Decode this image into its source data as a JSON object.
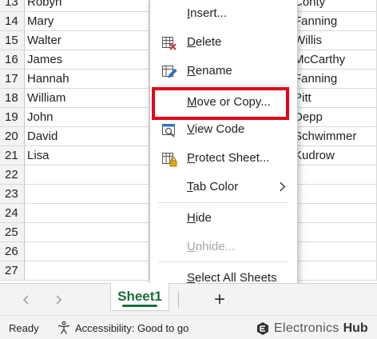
{
  "grid": {
    "rows": [
      {
        "num": "13",
        "a": "Robyn",
        "c": "Conty"
      },
      {
        "num": "14",
        "a": "Mary",
        "c": "Fanning"
      },
      {
        "num": "15",
        "a": "Walter",
        "c": "Willis"
      },
      {
        "num": "16",
        "a": "James",
        "c": "McCarthy"
      },
      {
        "num": "17",
        "a": "Hannah",
        "c": "Fanning"
      },
      {
        "num": "18",
        "a": "William",
        "c": "Pitt"
      },
      {
        "num": "19",
        "a": "John",
        "c": "Depp"
      },
      {
        "num": "20",
        "a": "David",
        "c": "Schwimmer"
      },
      {
        "num": "21",
        "a": "Lisa",
        "c": "Kudrow"
      },
      {
        "num": "22",
        "a": "",
        "c": ""
      },
      {
        "num": "23",
        "a": "",
        "c": ""
      },
      {
        "num": "24",
        "a": "",
        "c": ""
      },
      {
        "num": "25",
        "a": "",
        "c": ""
      },
      {
        "num": "26",
        "a": "",
        "c": ""
      },
      {
        "num": "27",
        "a": "",
        "c": ""
      }
    ]
  },
  "context_menu": {
    "items": [
      {
        "label_pre": "",
        "label_u": "I",
        "label_post": "nsert...",
        "icon": "",
        "disabled": false
      },
      {
        "label_pre": "",
        "label_u": "D",
        "label_post": "elete",
        "icon": "delete-sheet-icon",
        "disabled": false
      },
      {
        "label_pre": "",
        "label_u": "R",
        "label_post": "ename",
        "icon": "rename-sheet-icon",
        "disabled": false
      },
      {
        "label_pre": "",
        "label_u": "M",
        "label_post": "ove or Copy...",
        "icon": "",
        "disabled": false
      },
      {
        "label_pre": "",
        "label_u": "V",
        "label_post": "iew Code",
        "icon": "view-code-icon",
        "disabled": false
      },
      {
        "label_pre": "",
        "label_u": "P",
        "label_post": "rotect Sheet...",
        "icon": "protect-sheet-icon",
        "disabled": false
      },
      {
        "label_pre": "",
        "label_u": "T",
        "label_post": "ab Color",
        "icon": "",
        "disabled": false,
        "submenu": "chevron-right-icon"
      },
      {
        "label_pre": "",
        "label_u": "H",
        "label_post": "ide",
        "icon": "",
        "disabled": false
      },
      {
        "label_pre": "",
        "label_u": "U",
        "label_post": "nhide...",
        "icon": "",
        "disabled": true
      },
      {
        "label_pre": "",
        "label_u": "S",
        "label_post": "elect All Sheets",
        "icon": "",
        "disabled": false
      }
    ],
    "highlighted_item": "Move or Copy...",
    "highlight_color": "#e3001b"
  },
  "tabbar": {
    "sheet_tab": "Sheet1",
    "add_label": "+",
    "accent": "#1e6b3a"
  },
  "statusbar": {
    "ready": "Ready",
    "accessibility": "Accessibility: Good to go"
  },
  "watermark": {
    "brand_left": "Electronics",
    "brand_right": "Hub"
  }
}
